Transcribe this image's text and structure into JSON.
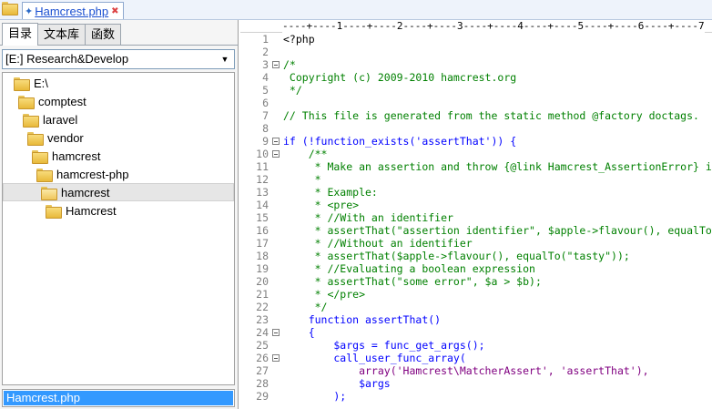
{
  "top_tab": {
    "file_label": "Hamcrest.php"
  },
  "left_panel": {
    "tabs": [
      "目录",
      "文本库",
      "函数"
    ],
    "drive_selector": "[E:] Research&Develop",
    "tree": [
      {
        "label": "E:\\",
        "indent": 0
      },
      {
        "label": "comptest",
        "indent": 1
      },
      {
        "label": "laravel",
        "indent": 2
      },
      {
        "label": "vendor",
        "indent": 3
      },
      {
        "label": "hamcrest",
        "indent": 4
      },
      {
        "label": "hamcrest-php",
        "indent": 5
      },
      {
        "label": "hamcrest",
        "indent": 6,
        "selected": true
      },
      {
        "label": "Hamcrest",
        "indent": 7
      }
    ],
    "file_list": [
      "Hamcrest.php"
    ]
  },
  "editor": {
    "ruler": "----+----1----+----2----+----3----+----4----+----5----+----6----+----7",
    "lines": [
      {
        "n": "1",
        "fold": false,
        "cls": "c-plain",
        "text": "<?php"
      },
      {
        "n": "2",
        "fold": false,
        "cls": "c-plain",
        "text": ""
      },
      {
        "n": "3",
        "fold": true,
        "cls": "c-com",
        "text": "/*"
      },
      {
        "n": "4",
        "fold": false,
        "cls": "c-com",
        "text": " Copyright (c) 2009-2010 hamcrest.org"
      },
      {
        "n": "5",
        "fold": false,
        "cls": "c-com",
        "text": " */"
      },
      {
        "n": "6",
        "fold": false,
        "cls": "c-plain",
        "text": ""
      },
      {
        "n": "7",
        "fold": false,
        "cls": "c-com",
        "text": "// This file is generated from the static method @factory doctags."
      },
      {
        "n": "8",
        "fold": false,
        "cls": "c-plain",
        "text": ""
      },
      {
        "n": "9",
        "fold": true,
        "cls": "c-kw",
        "text": "if (!function_exists('assertThat')) {"
      },
      {
        "n": "10",
        "fold": true,
        "cls": "c-com",
        "text": "    /**"
      },
      {
        "n": "11",
        "fold": false,
        "cls": "c-com",
        "text": "     * Make an assertion and throw {@link Hamcrest_AssertionError} if it fails."
      },
      {
        "n": "12",
        "fold": false,
        "cls": "c-com",
        "text": "     *"
      },
      {
        "n": "13",
        "fold": false,
        "cls": "c-com",
        "text": "     * Example:"
      },
      {
        "n": "14",
        "fold": false,
        "cls": "c-com",
        "text": "     * <pre>"
      },
      {
        "n": "15",
        "fold": false,
        "cls": "c-com",
        "text": "     * //With an identifier"
      },
      {
        "n": "16",
        "fold": false,
        "cls": "c-com",
        "text": "     * assertThat(\"assertion identifier\", $apple->flavour(), equalTo(\"tasty\"));"
      },
      {
        "n": "17",
        "fold": false,
        "cls": "c-com",
        "text": "     * //Without an identifier"
      },
      {
        "n": "18",
        "fold": false,
        "cls": "c-com",
        "text": "     * assertThat($apple->flavour(), equalTo(\"tasty\"));"
      },
      {
        "n": "19",
        "fold": false,
        "cls": "c-com",
        "text": "     * //Evaluating a boolean expression"
      },
      {
        "n": "20",
        "fold": false,
        "cls": "c-com",
        "text": "     * assertThat(\"some error\", $a > $b);"
      },
      {
        "n": "21",
        "fold": false,
        "cls": "c-com",
        "text": "     * </pre>"
      },
      {
        "n": "22",
        "fold": false,
        "cls": "c-com",
        "text": "     */"
      },
      {
        "n": "23",
        "fold": false,
        "cls": "c-kw",
        "text": "    function assertThat()"
      },
      {
        "n": "24",
        "fold": true,
        "cls": "c-kw",
        "text": "    {"
      },
      {
        "n": "25",
        "fold": false,
        "cls": "c-var",
        "text": "        $args = func_get_args();"
      },
      {
        "n": "26",
        "fold": true,
        "cls": "c-kw",
        "text": "        call_user_func_array("
      },
      {
        "n": "27",
        "fold": false,
        "cls": "c-str",
        "text": "            array('Hamcrest\\MatcherAssert', 'assertThat'),"
      },
      {
        "n": "28",
        "fold": false,
        "cls": "c-var",
        "text": "            $args"
      },
      {
        "n": "29",
        "fold": false,
        "cls": "c-kw",
        "text": "        );"
      }
    ]
  }
}
